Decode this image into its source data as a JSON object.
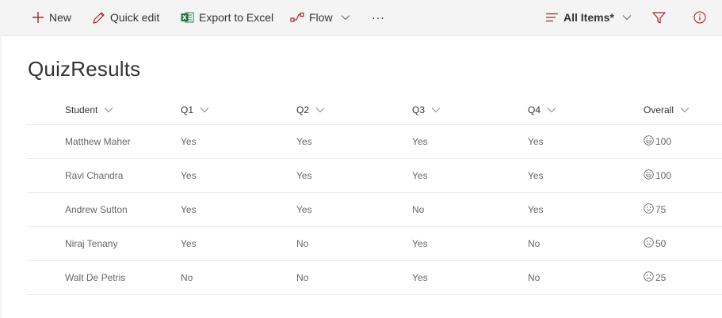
{
  "toolbar": {
    "new_label": "New",
    "quick_edit_label": "Quick edit",
    "export_label": "Export to Excel",
    "flow_label": "Flow",
    "more_label": "···",
    "view_label": "All Items*"
  },
  "colors": {
    "accent": "#a4262c",
    "excel": "#217346"
  },
  "page": {
    "title": "QuizResults"
  },
  "columns": [
    "Student",
    "Q1",
    "Q2",
    "Q3",
    "Q4",
    "Overall"
  ],
  "rows": [
    {
      "student": "Matthew Maher",
      "q1": "Yes",
      "q2": "Yes",
      "q3": "Yes",
      "q4": "Yes",
      "icon": "very-happy-face-icon",
      "overall": "100"
    },
    {
      "student": "Ravi Chandra",
      "q1": "Yes",
      "q2": "Yes",
      "q3": "Yes",
      "q4": "Yes",
      "icon": "very-happy-face-icon",
      "overall": "100"
    },
    {
      "student": "Andrew Sutton",
      "q1": "Yes",
      "q2": "Yes",
      "q3": "No",
      "q4": "Yes",
      "icon": "happy-face-icon",
      "overall": "75"
    },
    {
      "student": "Niraj Tenany",
      "q1": "Yes",
      "q2": "No",
      "q3": "Yes",
      "q4": "No",
      "icon": "neutral-face-icon",
      "overall": "50"
    },
    {
      "student": "Walt De Petris",
      "q1": "No",
      "q2": "No",
      "q3": "Yes",
      "q4": "No",
      "icon": "sad-face-icon",
      "overall": "25"
    }
  ]
}
